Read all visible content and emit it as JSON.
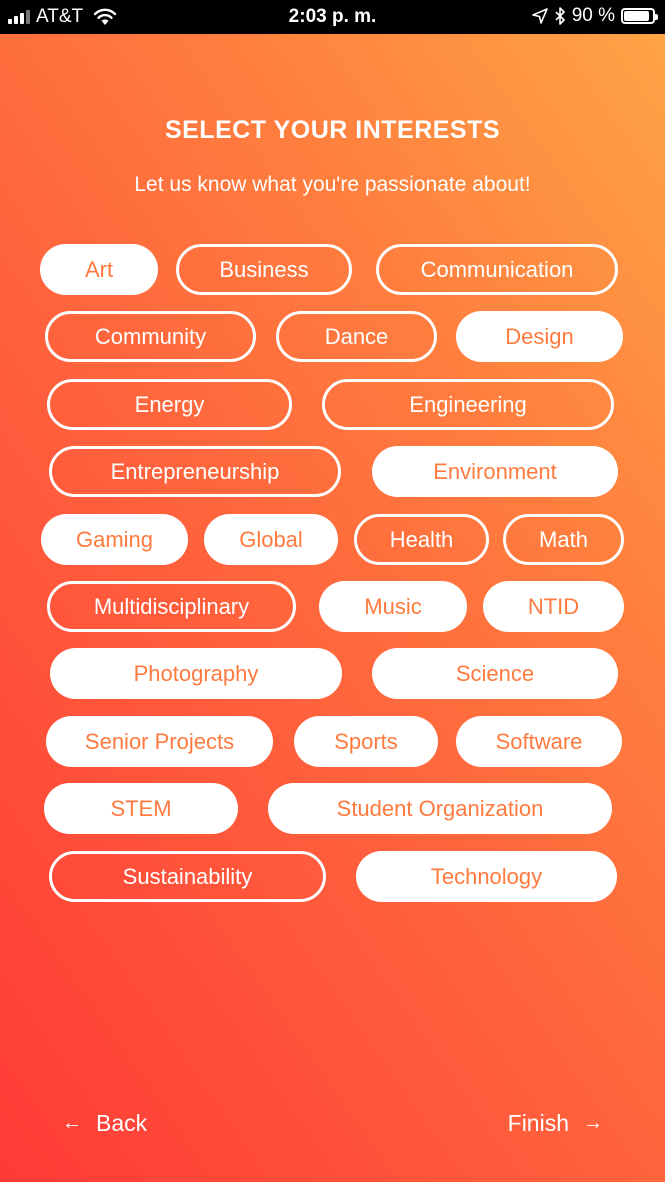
{
  "status_bar": {
    "carrier": "AT&T",
    "time": "2:03 p. m.",
    "battery_text": "90 %",
    "battery_level": 0.9,
    "icons": [
      "signal-icon",
      "wifi-icon",
      "location-arrow-icon",
      "bluetooth-icon",
      "battery-icon"
    ]
  },
  "header": {
    "title": "SELECT YOUR INTERESTS",
    "subtitle": "Let us know what you're passionate about!"
  },
  "colors": {
    "accent": "#ff7a3f",
    "gradient_start": "#ff3a36",
    "gradient_end": "#fea646"
  },
  "interests": [
    {
      "label": "Art",
      "selected": true
    },
    {
      "label": "Business",
      "selected": false
    },
    {
      "label": "Communication",
      "selected": false
    },
    {
      "label": "Community",
      "selected": false
    },
    {
      "label": "Dance",
      "selected": false
    },
    {
      "label": "Design",
      "selected": true
    },
    {
      "label": "Energy",
      "selected": false
    },
    {
      "label": "Engineering",
      "selected": false
    },
    {
      "label": "Entrepreneurship",
      "selected": false
    },
    {
      "label": "Environment",
      "selected": true
    },
    {
      "label": "Gaming",
      "selected": true
    },
    {
      "label": "Global",
      "selected": true
    },
    {
      "label": "Health",
      "selected": false
    },
    {
      "label": "Math",
      "selected": false
    },
    {
      "label": "Multidisciplinary",
      "selected": false
    },
    {
      "label": "Music",
      "selected": true
    },
    {
      "label": "NTID",
      "selected": true
    },
    {
      "label": "Photography",
      "selected": true
    },
    {
      "label": "Science",
      "selected": true
    },
    {
      "label": "Senior Projects",
      "selected": true
    },
    {
      "label": "Sports",
      "selected": true
    },
    {
      "label": "Software",
      "selected": true
    },
    {
      "label": "STEM",
      "selected": true
    },
    {
      "label": "Student Organization",
      "selected": true
    },
    {
      "label": "Sustainability",
      "selected": false
    },
    {
      "label": "Technology",
      "selected": true
    }
  ],
  "footer": {
    "back_label": "Back",
    "back_arrow": "←",
    "finish_label": "Finish",
    "finish_arrow": "→"
  }
}
